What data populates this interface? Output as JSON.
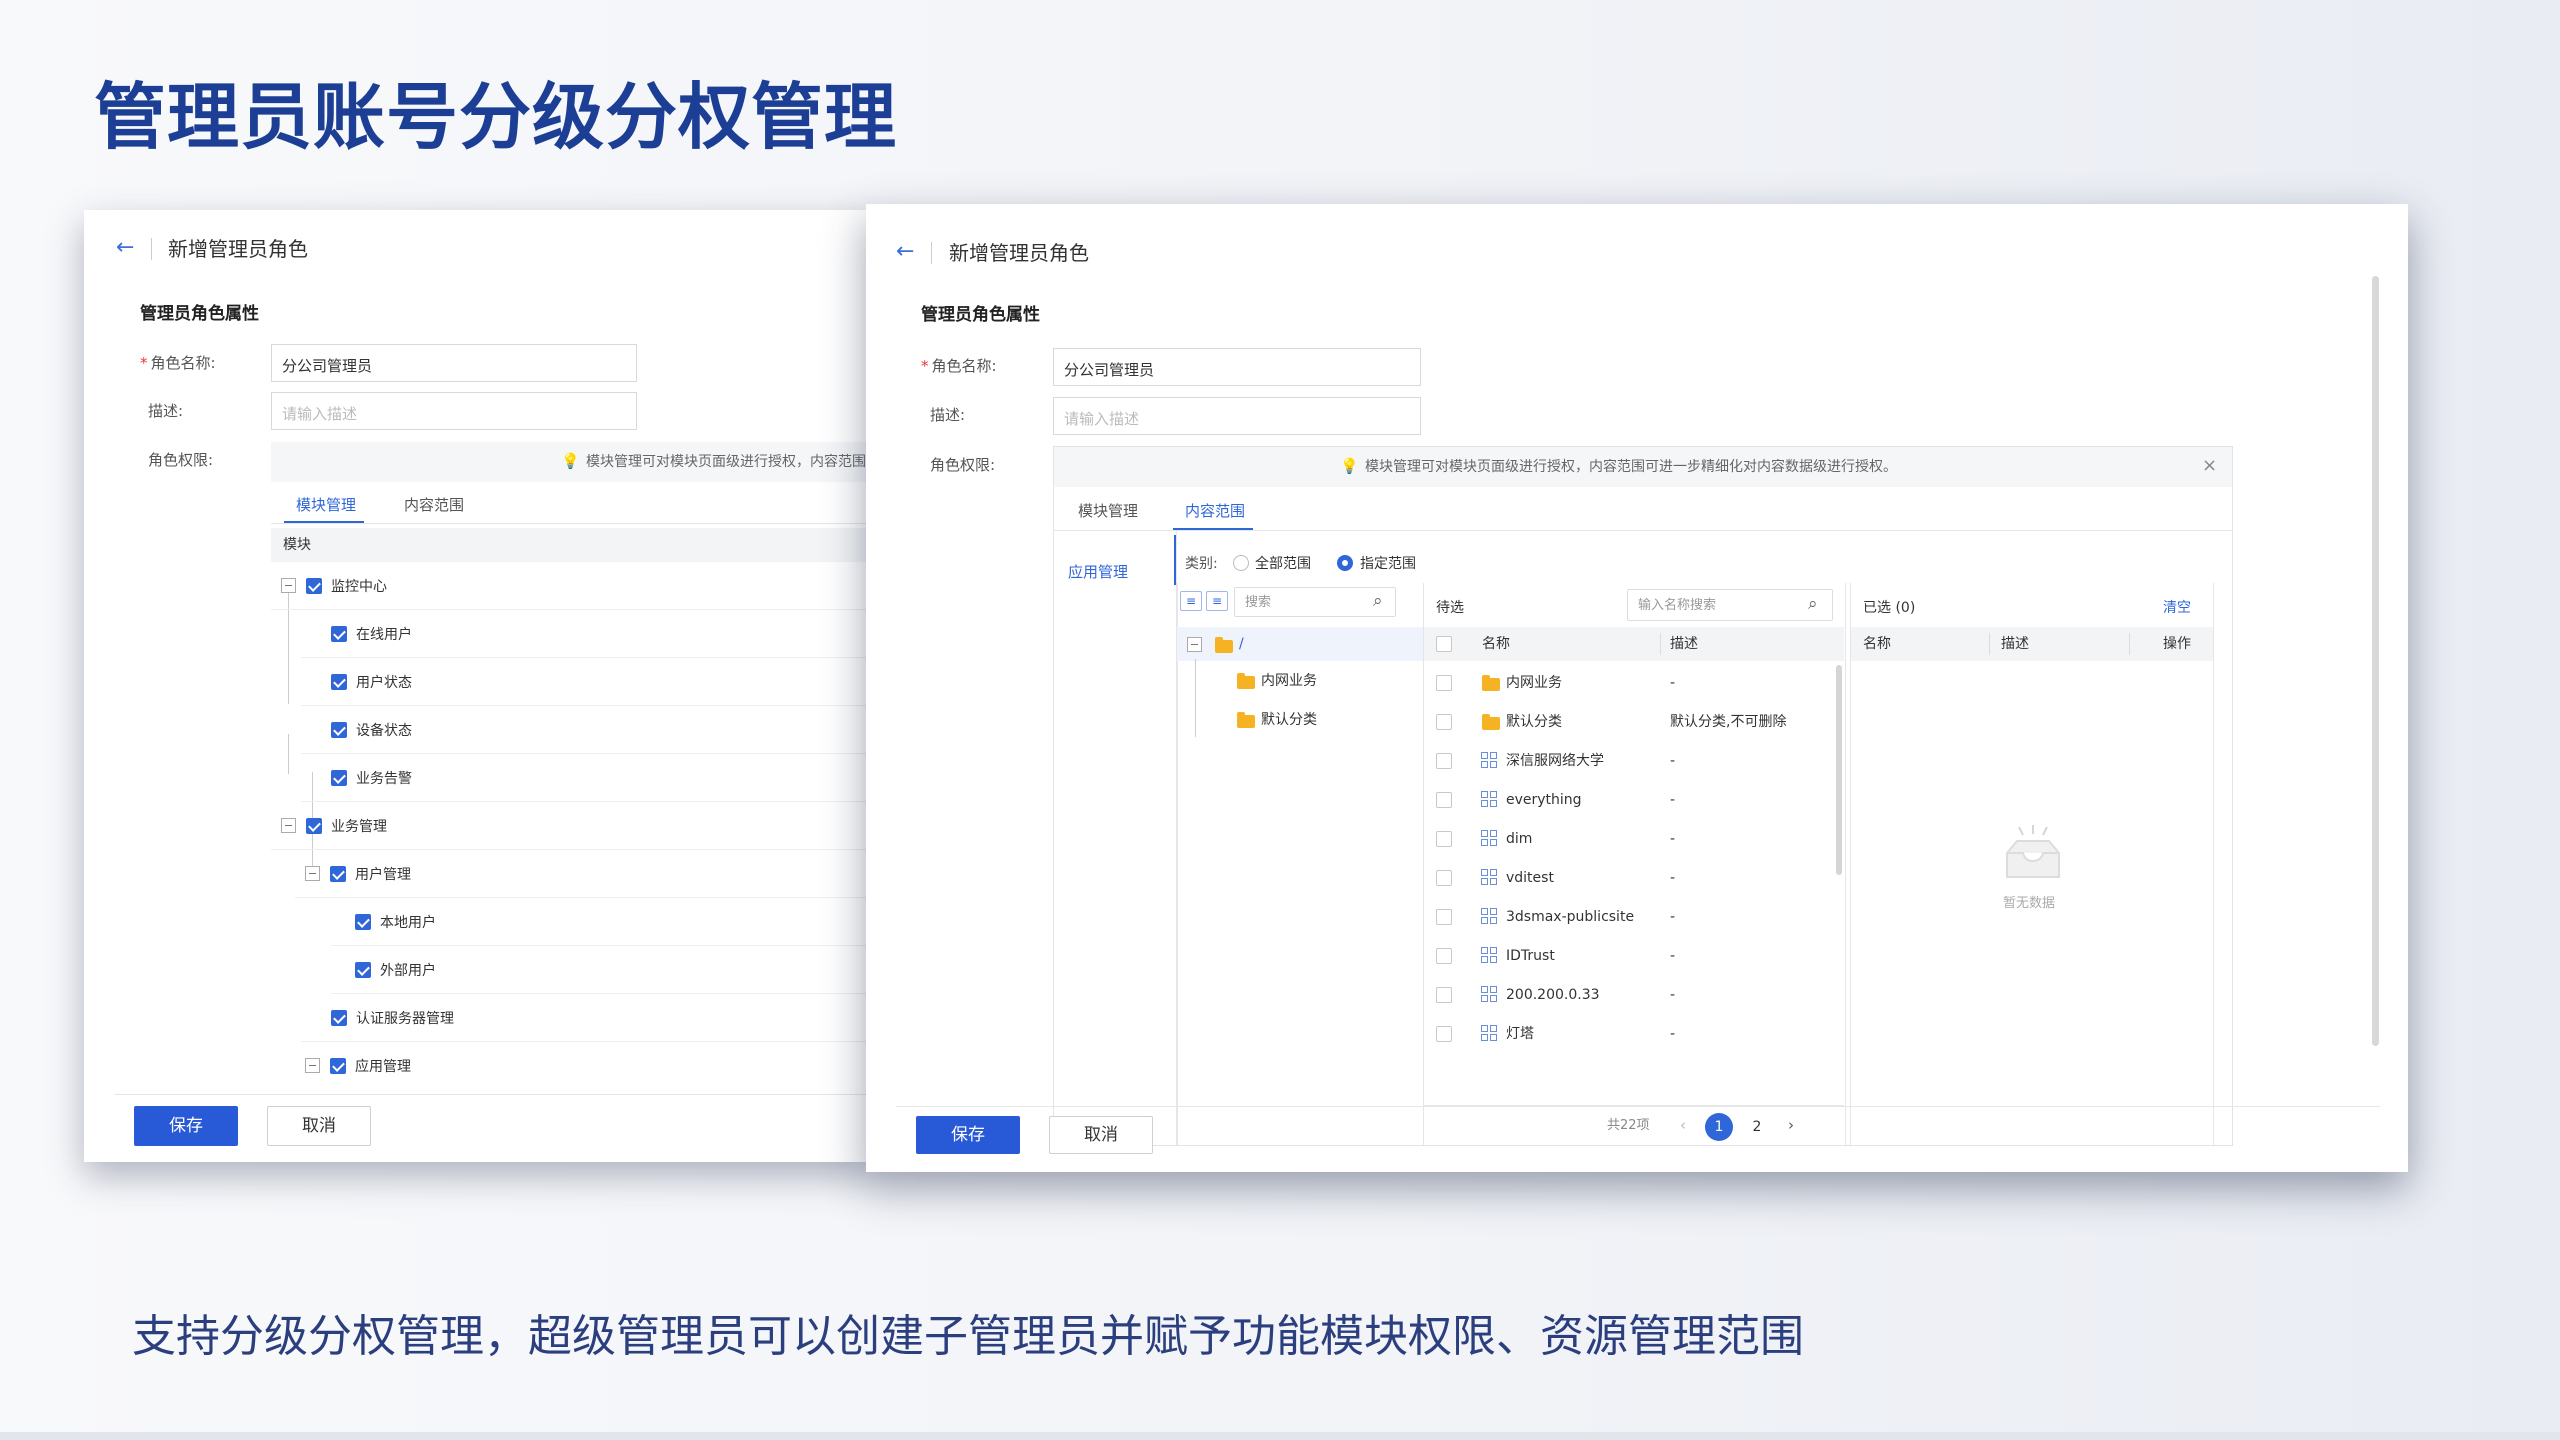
{
  "slide": {
    "title": "管理员账号分级分权管理",
    "caption": "支持分级分权管理，超级管理员可以创建子管理员并赋予功能模块权限、资源管理范围"
  },
  "form": {
    "page_title": "新增管理员角色",
    "section_title": "管理员角色属性",
    "role_name_label": "角色名称:",
    "role_name_value": "分公司管理员",
    "desc_label": "描述:",
    "desc_placeholder": "请输入描述",
    "perm_label": "角色权限:",
    "notice": "模块管理可对模块页面级进行授权，内容范围可进一步精细化对内容数据级进行授权。",
    "notice_short": "模块管理可对模块页面级进行授权，内容范围",
    "tabs": [
      "模块管理",
      "内容范围"
    ],
    "save": "保存",
    "cancel": "取消"
  },
  "left_tree": {
    "header": "模块",
    "items": [
      {
        "label": "监控中心"
      },
      {
        "label": "在线用户"
      },
      {
        "label": "用户状态"
      },
      {
        "label": "设备状态"
      },
      {
        "label": "业务告警"
      },
      {
        "label": "业务管理"
      },
      {
        "label": "用户管理"
      },
      {
        "label": "本地用户"
      },
      {
        "label": "外部用户"
      },
      {
        "label": "认证服务器管理"
      },
      {
        "label": "应用管理"
      }
    ]
  },
  "content_scope": {
    "side_item": "应用管理",
    "category_label": "类别:",
    "option_all": "全部范围",
    "option_specified": "指定范围",
    "tree_search_placeholder": "搜索",
    "tree_root": "/",
    "tree_children": [
      "内网业务",
      "默认分类"
    ],
    "pending_title": "待选",
    "pending_search_placeholder": "输入名称搜索",
    "columns": [
      "名称",
      "描述"
    ],
    "rows": [
      {
        "name": "内网业务",
        "desc": "-",
        "icon": "folder-icon"
      },
      {
        "name": "默认分类",
        "desc": "默认分类,不可删除",
        "icon": "folder-icon"
      },
      {
        "name": "深信服网络大学",
        "desc": "-",
        "icon": "app-grid-icon"
      },
      {
        "name": "everything",
        "desc": "-",
        "icon": "app-grid-icon"
      },
      {
        "name": "dim",
        "desc": "-",
        "icon": "app-grid-icon"
      },
      {
        "name": "vditest",
        "desc": "-",
        "icon": "app-grid-icon"
      },
      {
        "name": "3dsmax-publicsite",
        "desc": "-",
        "icon": "app-grid-icon"
      },
      {
        "name": "IDTrust",
        "desc": "-",
        "icon": "app-grid-icon"
      },
      {
        "name": "200.200.0.33",
        "desc": "-",
        "icon": "app-grid-icon"
      },
      {
        "name": "灯塔",
        "desc": "-",
        "icon": "app-grid-icon"
      }
    ],
    "total": "共22项",
    "pages": [
      "1",
      "2"
    ],
    "current_page": "1",
    "selected_title": "已选 (0)",
    "clear": "清空",
    "selected_columns": [
      "名称",
      "描述",
      "操作"
    ],
    "empty_text": "暂无数据"
  },
  "colors": {
    "accent": "#2f67d9",
    "title": "#1c3f95",
    "primary_button": "#2859d6"
  }
}
